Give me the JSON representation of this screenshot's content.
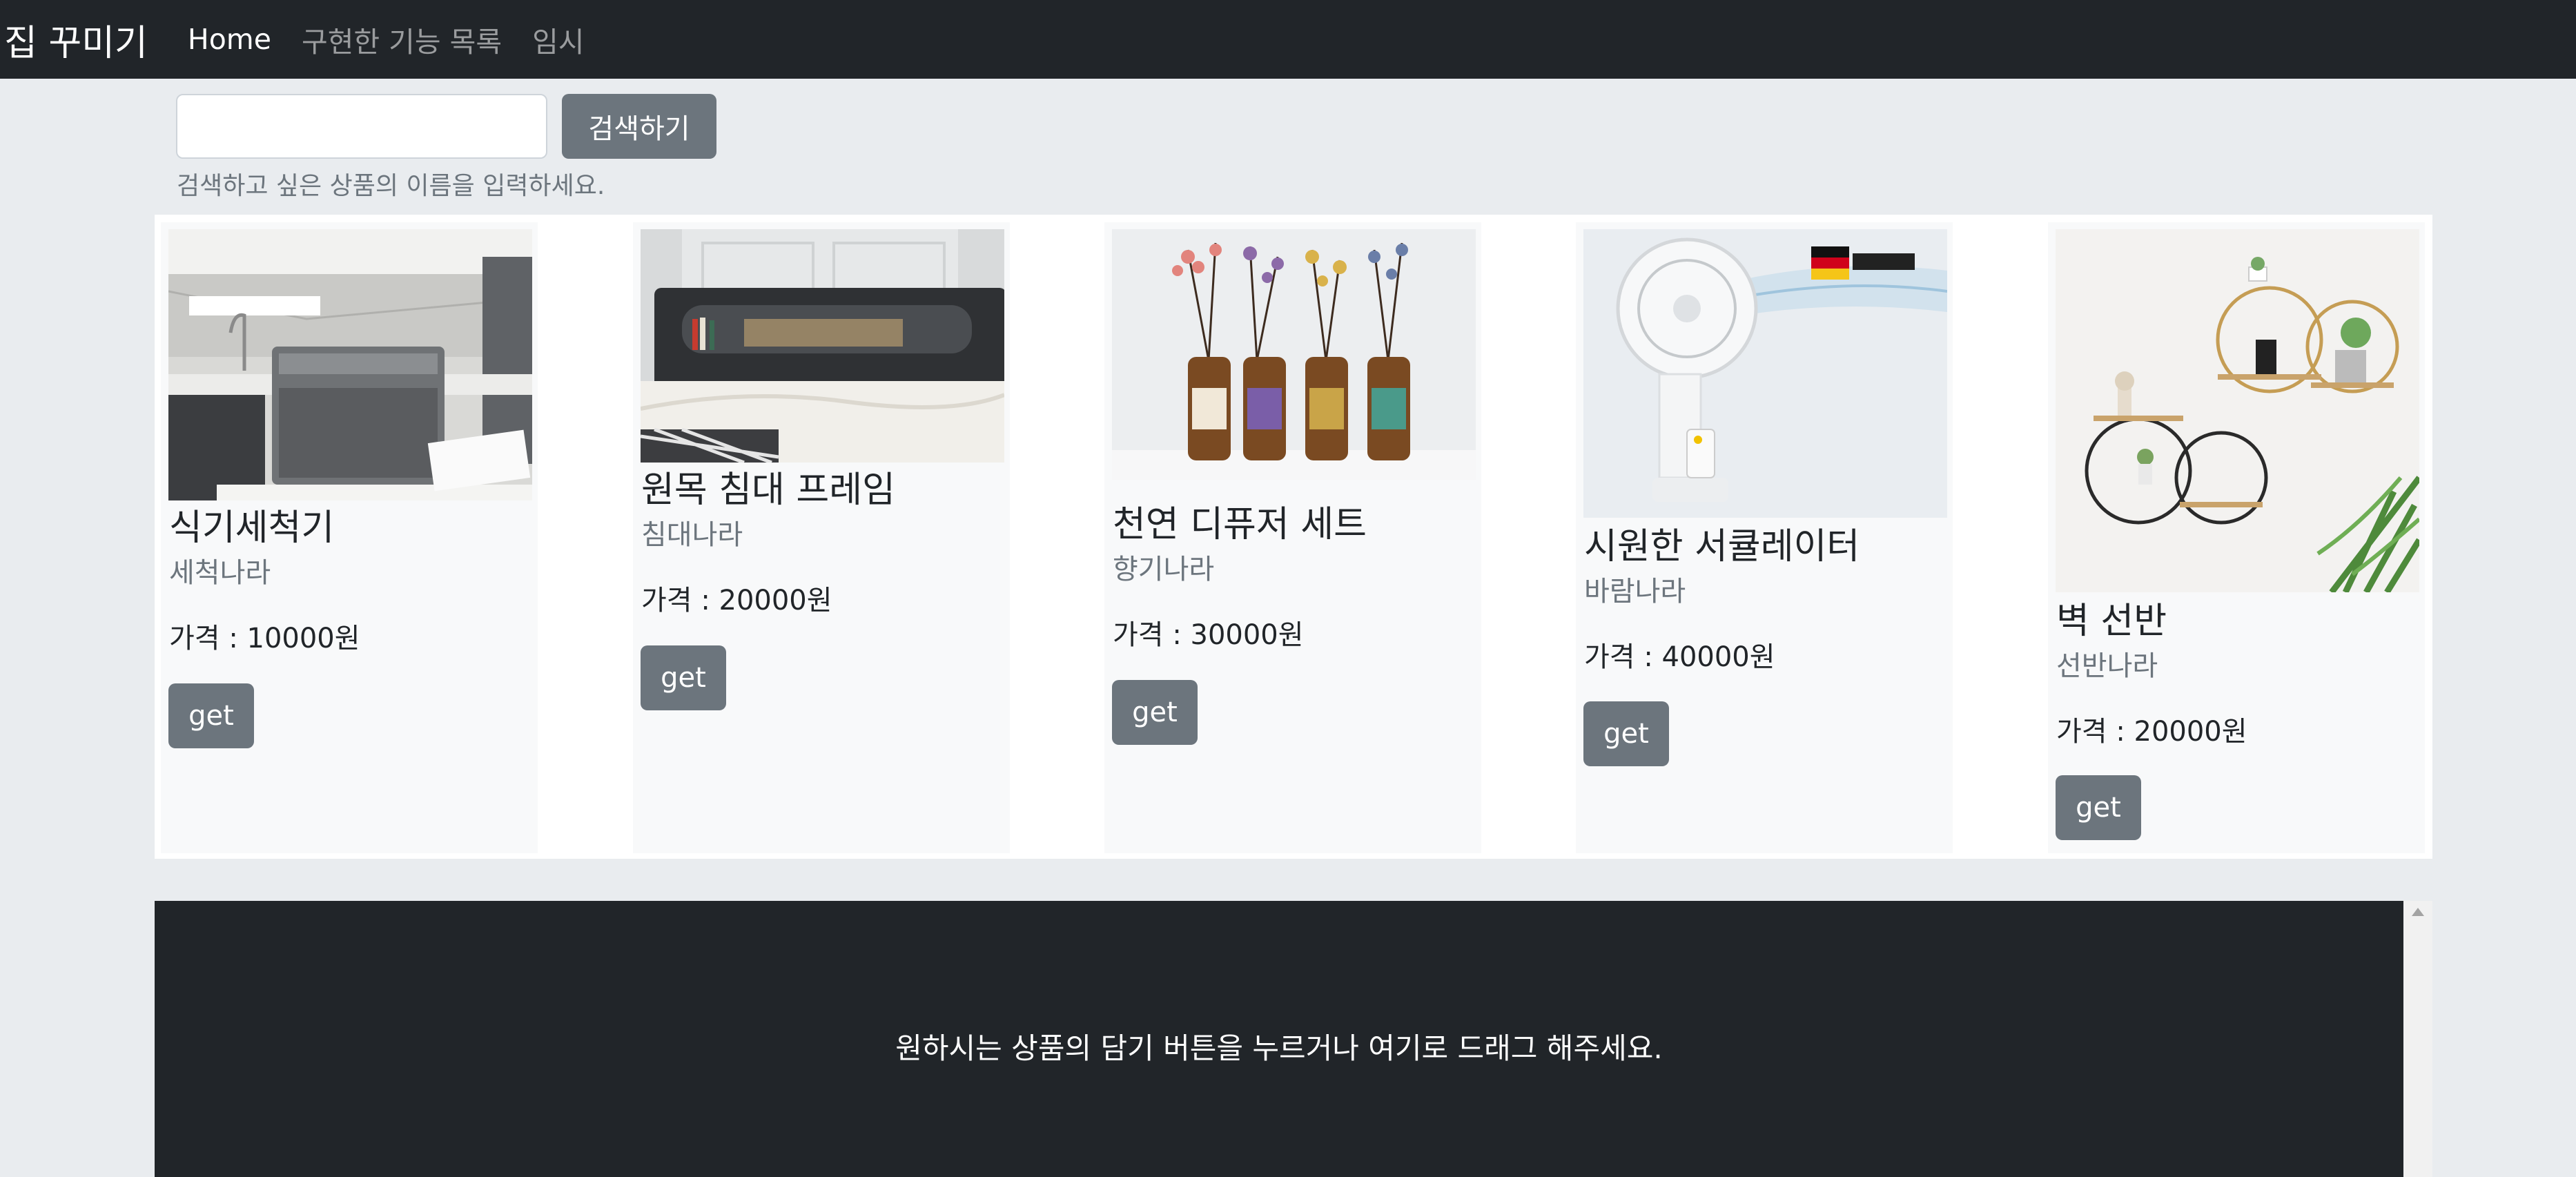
{
  "navbar": {
    "brand": "집 꾸미기",
    "links": [
      {
        "label": "Home",
        "active": true
      },
      {
        "label": "구현한 기능 목록",
        "active": false
      },
      {
        "label": "임시",
        "active": false
      }
    ]
  },
  "search": {
    "value": "",
    "placeholder": "",
    "button_label": "검색하기",
    "help_text": "검색하고 싶은 상품의 이름을 입력하세요."
  },
  "products": [
    {
      "title": "식기세척기",
      "seller": "세척나라",
      "price": "가격 : 10000원",
      "button_label": "get",
      "image": "dishwasher-photo"
    },
    {
      "title": "원목 침대 프레임",
      "seller": "침대나라",
      "price": "가격 : 20000원",
      "button_label": "get",
      "image": "bed-frame-photo"
    },
    {
      "title": "천연 디퓨저 세트",
      "seller": "향기나라",
      "price": "가격 : 30000원",
      "button_label": "get",
      "image": "diffuser-set-photo"
    },
    {
      "title": "시원한 서큘레이터",
      "seller": "바람나라",
      "price": "가격 : 40000원",
      "button_label": "get",
      "image": "circulator-fan-photo"
    },
    {
      "title": "벽 선반",
      "seller": "선반나라",
      "price": "가격 : 20000원",
      "button_label": "get",
      "image": "wall-shelf-photo"
    }
  ],
  "cart": {
    "message": "원하시는 상품의 담기 버튼을 누르거나 여기로 드래그 해주세요."
  },
  "colors": {
    "navbar_bg": "#212529",
    "page_bg": "#e9ecef",
    "button_bg": "#6c757d",
    "card_bg": "#f8f9fa"
  }
}
